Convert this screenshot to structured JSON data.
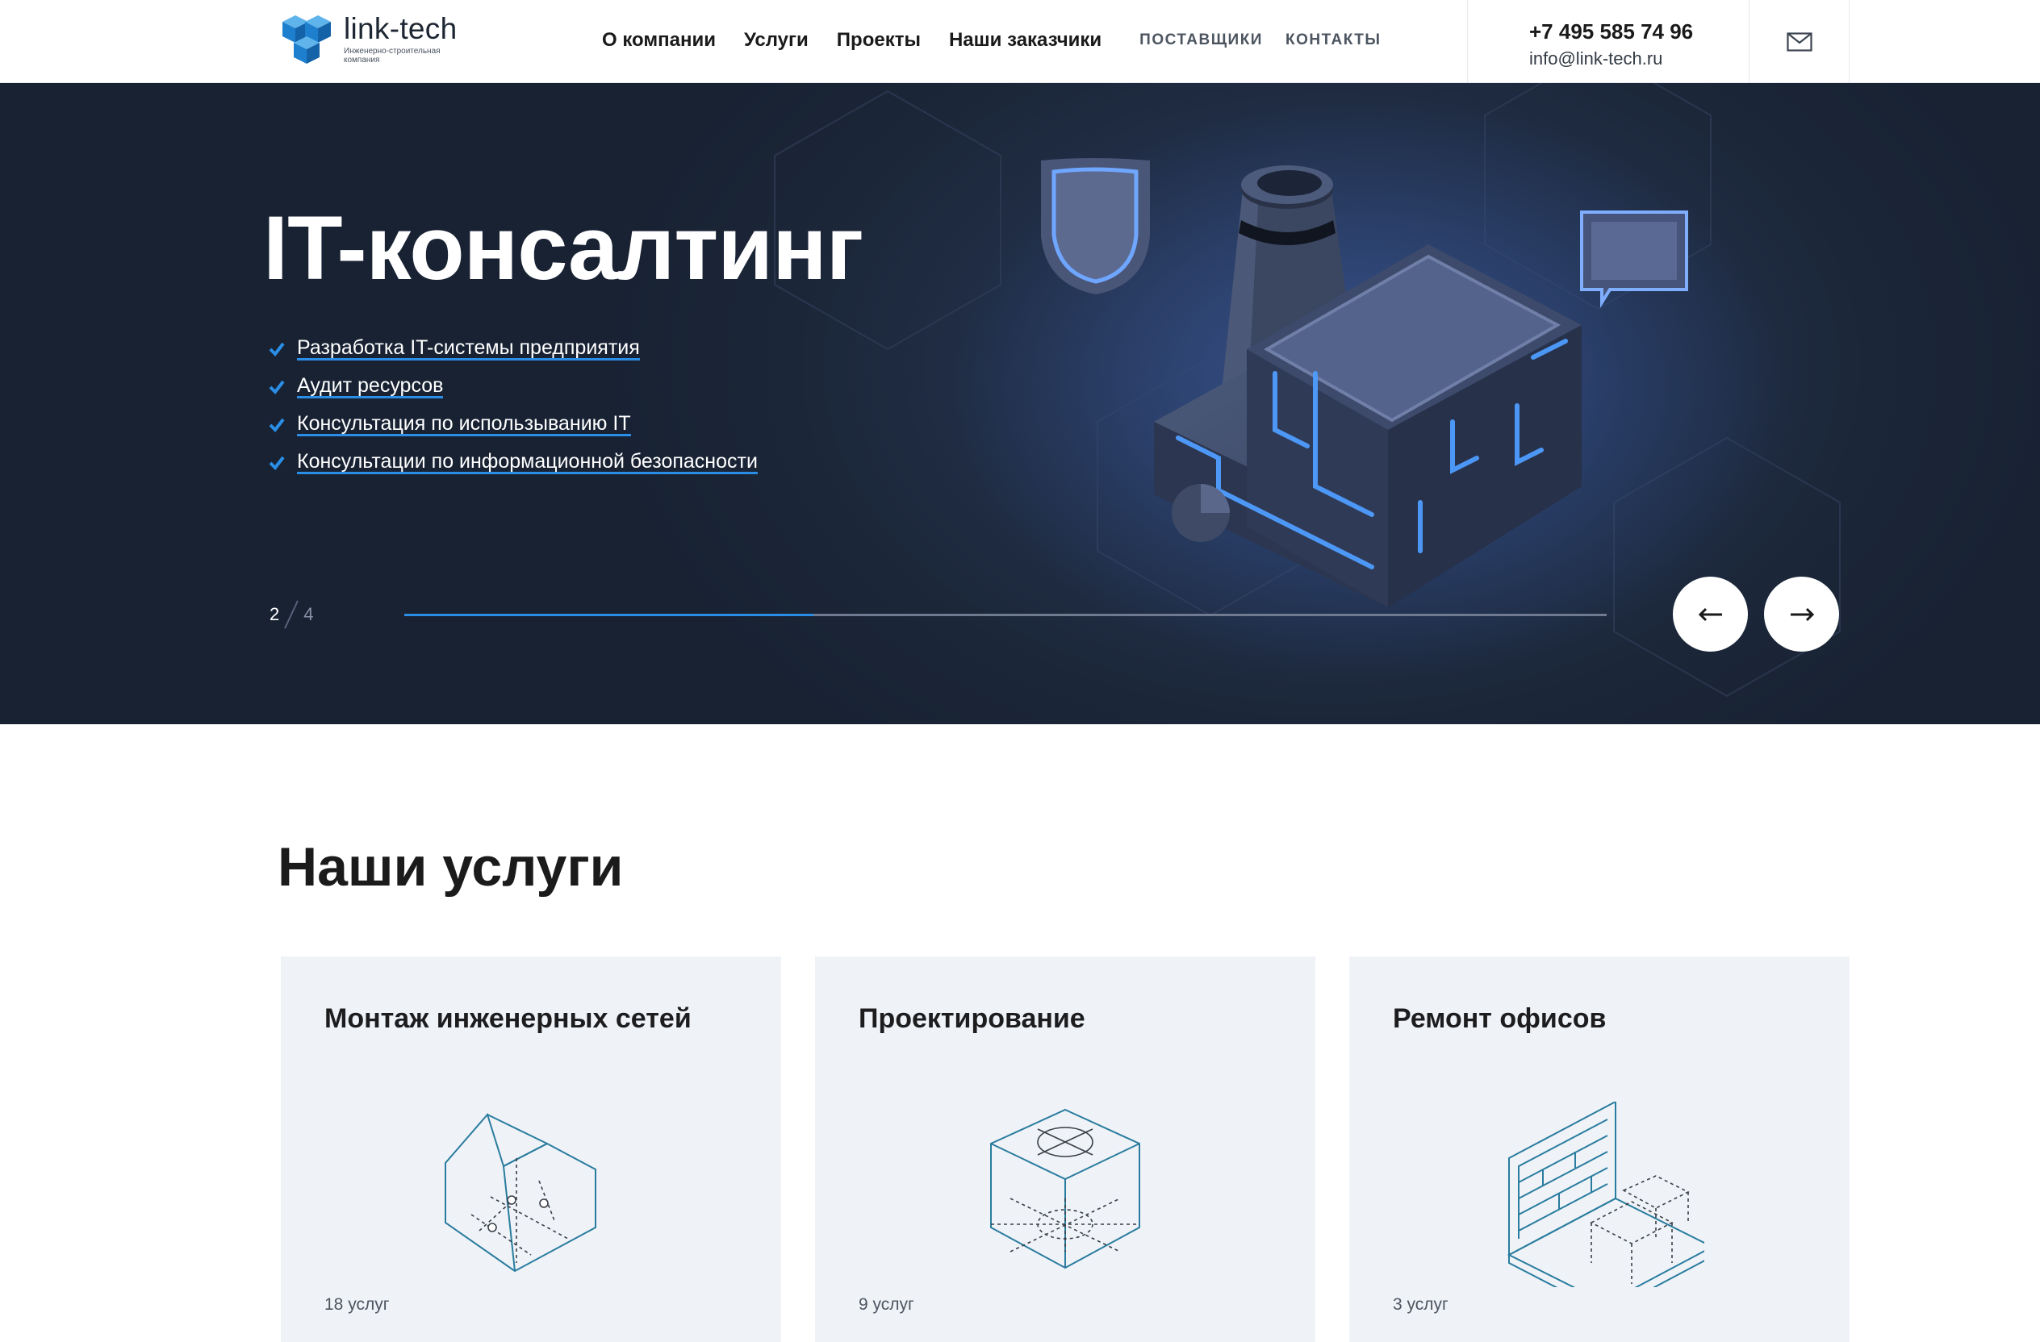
{
  "header": {
    "logo": {
      "name": "link-tech",
      "tagline": "Инженерно-строительная компания"
    },
    "nav": [
      {
        "label": "О компании"
      },
      {
        "label": "Услуги"
      },
      {
        "label": "Проекты"
      },
      {
        "label": "Наши заказчики"
      }
    ],
    "nav_secondary": [
      {
        "label": "ПОСТАВЩИКИ"
      },
      {
        "label": "КОНТАКТЫ"
      }
    ],
    "phone": "+7 495 585 74 96",
    "email": "info@link-tech.ru",
    "mail_icon": "envelope-icon"
  },
  "hero": {
    "title": "IT-консалтинг",
    "items": [
      "Разработка IT-системы предприятия",
      "Аудит ресурсов",
      "Консультация по использыванию IT",
      "Консультации по информационной безопасности"
    ],
    "slide_current": "2",
    "slide_total": "4",
    "progress_fraction": 0.34,
    "prev_icon": "arrow-left-icon",
    "next_icon": "arrow-right-icon",
    "accent_color": "#2b8ee6"
  },
  "services": {
    "title": "Наши услуги",
    "cards": [
      {
        "title": "Монтаж инженерных сетей",
        "count": "18 услуг",
        "icon": "house-network-icon"
      },
      {
        "title": "Проектирование",
        "count": "9 услуг",
        "icon": "cube-blueprint-icon"
      },
      {
        "title": "Ремонт офисов",
        "count": "3 услуг",
        "icon": "office-room-icon"
      }
    ]
  }
}
